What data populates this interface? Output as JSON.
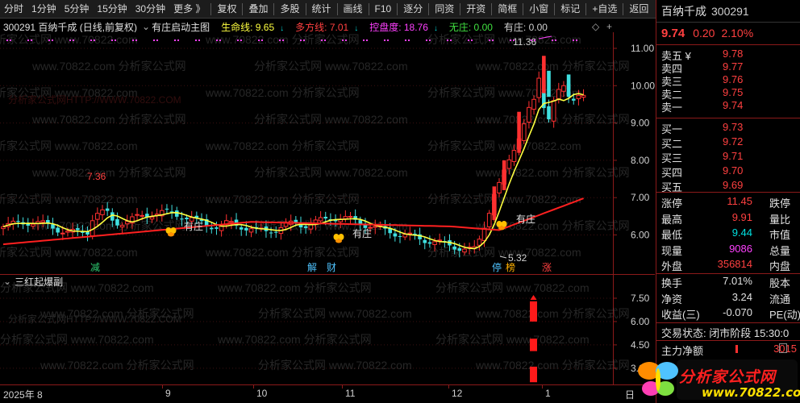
{
  "toolbar": {
    "periods": [
      "分时",
      "1分钟",
      "5分钟",
      "15分钟",
      "30分钟",
      "更多 》"
    ],
    "actions": [
      "复权",
      "叠加",
      "多股",
      "统计",
      "画线",
      "F10",
      "逐分",
      "同资",
      "开资",
      "简框",
      "小窗",
      "标记",
      "+自选",
      "返回"
    ]
  },
  "chart_header": {
    "title": "300291  百纳千成 (日线,前复权)",
    "indicator": "有庄启动主图",
    "lines": [
      {
        "label": "生命线: 9.65",
        "color": "#ffff40"
      },
      {
        "label": "多方线: 7.01",
        "color": "#ff4040"
      },
      {
        "label": "控盘度: 18.76",
        "color": "#ff40ff"
      },
      {
        "label": "无庄: 0.00",
        "color": "#40e040"
      },
      {
        "label": "有庄: 0.00",
        "color": "#d0d0d0"
      }
    ]
  },
  "main_axis": {
    "ticks": [
      "11.00",
      "10.00",
      "9.00",
      "8.00",
      "7.00",
      "6.00"
    ]
  },
  "annotations": {
    "high_label": "11.36",
    "low_label": "5.32",
    "early_high": "7.36",
    "youzhuang": "有庄",
    "markers": [
      "减",
      "解",
      "财",
      "停",
      "榜",
      "涨"
    ]
  },
  "watermarks": [
    "分析家公式网",
    "www.70822.com",
    "分析家公式网HTTP://WWW.70822.COM"
  ],
  "sub_header": {
    "title": "三红起爆副"
  },
  "sub_axis": {
    "ticks": [
      "7.50",
      "6.00",
      "4.50",
      "3.00"
    ]
  },
  "x_axis": {
    "labels": [
      "2025年 8",
      "9",
      "10",
      "11",
      "12",
      "1",
      "日"
    ]
  },
  "right_panel": {
    "name": "百纳千成",
    "code": "300291",
    "price": "9.74",
    "change": "0.20",
    "change_pct": "2.10%",
    "asks": [
      {
        "label": "卖五 ¥",
        "price": "9.78"
      },
      {
        "label": "卖四",
        "price": "9.77"
      },
      {
        "label": "卖三",
        "price": "9.76"
      },
      {
        "label": "卖二",
        "price": "9.75"
      },
      {
        "label": "卖一",
        "price": "9.74"
      }
    ],
    "bids": [
      {
        "label": "买一",
        "price": "9.73"
      },
      {
        "label": "买二",
        "price": "9.72"
      },
      {
        "label": "买三",
        "price": "9.71"
      },
      {
        "label": "买四",
        "price": "9.70"
      },
      {
        "label": "买五",
        "price": "9.69"
      }
    ],
    "stats1": [
      {
        "l1": "涨停",
        "v1": "11.45",
        "c1": "#ff4040",
        "l2": "跌停"
      },
      {
        "l1": "最高",
        "v1": "9.91",
        "c1": "#ff4040",
        "l2": "量比"
      },
      {
        "l1": "最低",
        "v1": "9.44",
        "c1": "#00e0e0",
        "l2": "市值"
      },
      {
        "l1": "现量",
        "v1": "9086",
        "c1": "#ff40ff",
        "l2": "总量"
      },
      {
        "l1": "外盘",
        "v1": "356814",
        "c1": "#ff4040",
        "l2": "内盘"
      }
    ],
    "stats2": [
      {
        "l1": "换手",
        "v1": "7.01%",
        "c1": "#e0e0e0",
        "l2": "股本"
      },
      {
        "l1": "净资",
        "v1": "3.24",
        "c1": "#e0e0e0",
        "l2": "流通"
      },
      {
        "l1": "收益(三)",
        "v1": "-0.070",
        "c1": "#e0e0e0",
        "l2": "PE(动)"
      }
    ],
    "trade_status": "交易状态: 闭市阶段 15:30:0",
    "net_inflow_label": "主力净额",
    "net_inflow_value": "3015"
  },
  "logo": {
    "title": "分析家公式网",
    "url": "www.70822.com"
  },
  "colors": {
    "up": "#ff3030",
    "down": "#40e0e0",
    "ma_short": "#ffff40",
    "ma_long": "#ff2020",
    "border": "#8b1a1a"
  }
}
